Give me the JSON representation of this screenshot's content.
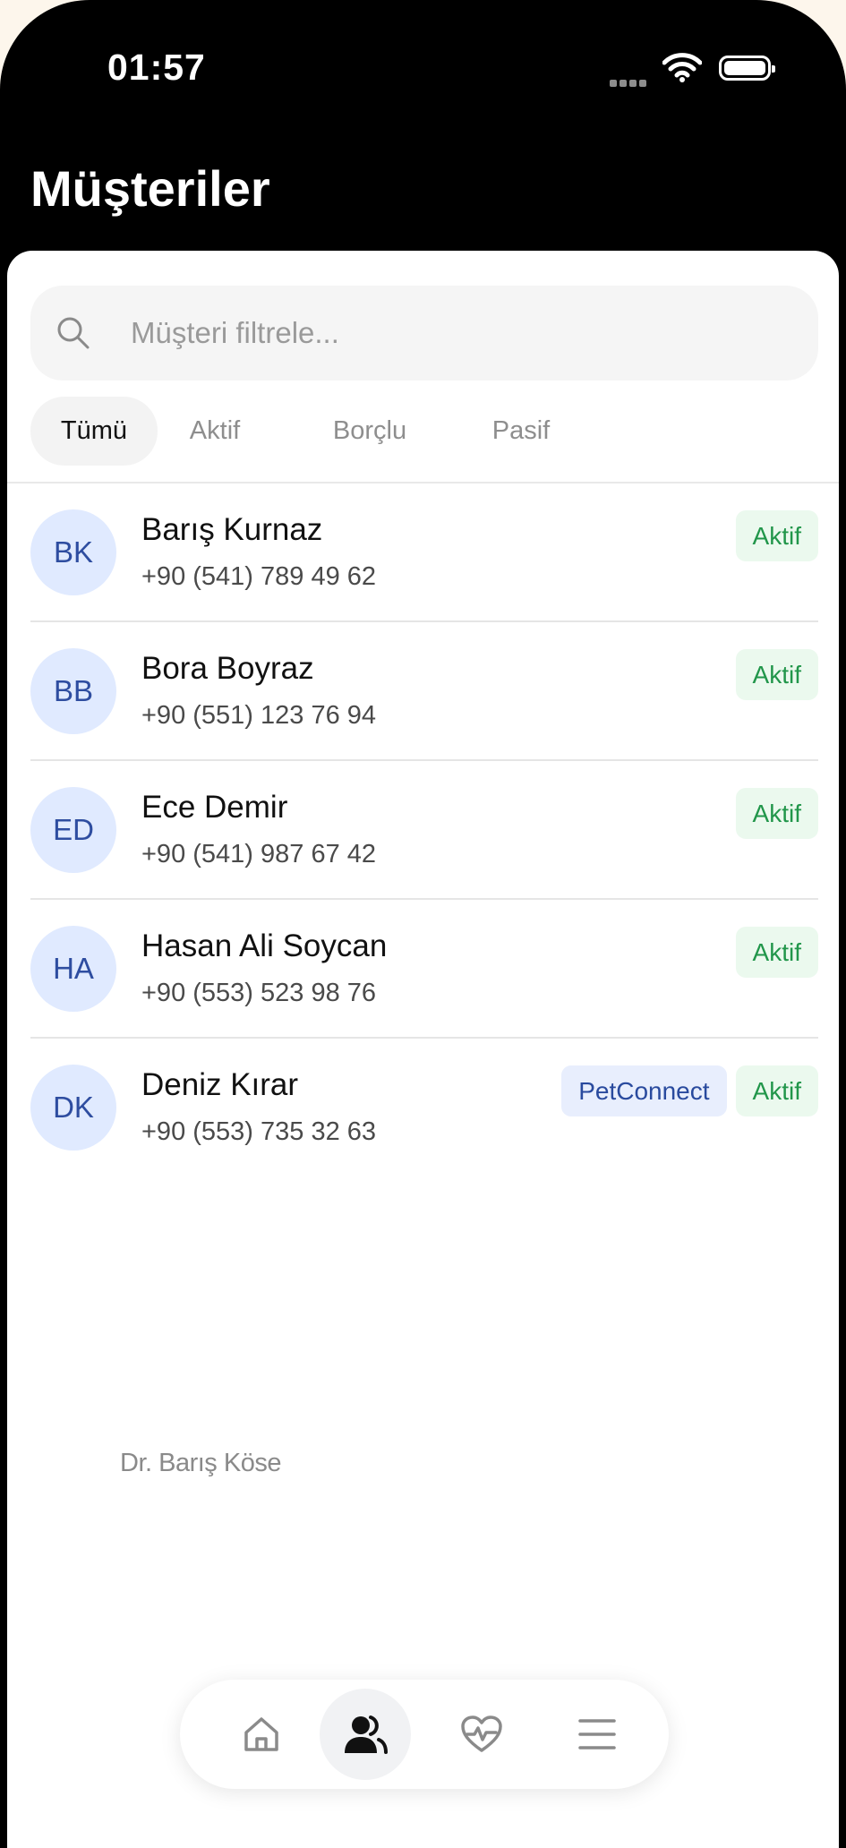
{
  "status_bar": {
    "time": "01:57"
  },
  "header": {
    "title": "Müşteriler"
  },
  "search": {
    "placeholder": "Müşteri filtrele..."
  },
  "tabs": [
    {
      "label": "Tümü",
      "active": true
    },
    {
      "label": "Aktif",
      "active": false
    },
    {
      "label": "Borçlu",
      "active": false
    },
    {
      "label": "Pasif",
      "active": false
    }
  ],
  "customers": [
    {
      "initials": "BK",
      "name": "Barış Kurnaz",
      "phone": "+90 (541) 789 49 62",
      "status": "Aktif"
    },
    {
      "initials": "BB",
      "name": "Bora Boyraz",
      "phone": "+90 (551) 123 76 94",
      "status": "Aktif"
    },
    {
      "initials": "ED",
      "name": "Ece Demir",
      "phone": "+90 (541) 987 67 42",
      "status": "Aktif"
    },
    {
      "initials": "HA",
      "name": "Hasan Ali Soycan",
      "phone": "+90 (553) 523 98 76",
      "status": "Aktif"
    },
    {
      "initials": "DK",
      "name": "Deniz Kırar",
      "phone": "+90 (553) 735 32 63",
      "status": "Aktif",
      "tag": "PetConnect"
    }
  ],
  "footer": {
    "doctor": "Dr. Barış Köse"
  },
  "bottom_nav": [
    {
      "icon": "home-icon",
      "active": false
    },
    {
      "icon": "customers-icon",
      "active": true
    },
    {
      "icon": "health-icon",
      "active": false
    },
    {
      "icon": "menu-icon",
      "active": false
    }
  ],
  "colors": {
    "active_badge_bg": "#ebf9ee",
    "active_badge_text": "#21964a",
    "tag_bg": "#e8eefd",
    "tag_text": "#294a9e",
    "avatar_bg": "#e0eaff",
    "avatar_text": "#2e4da0"
  }
}
